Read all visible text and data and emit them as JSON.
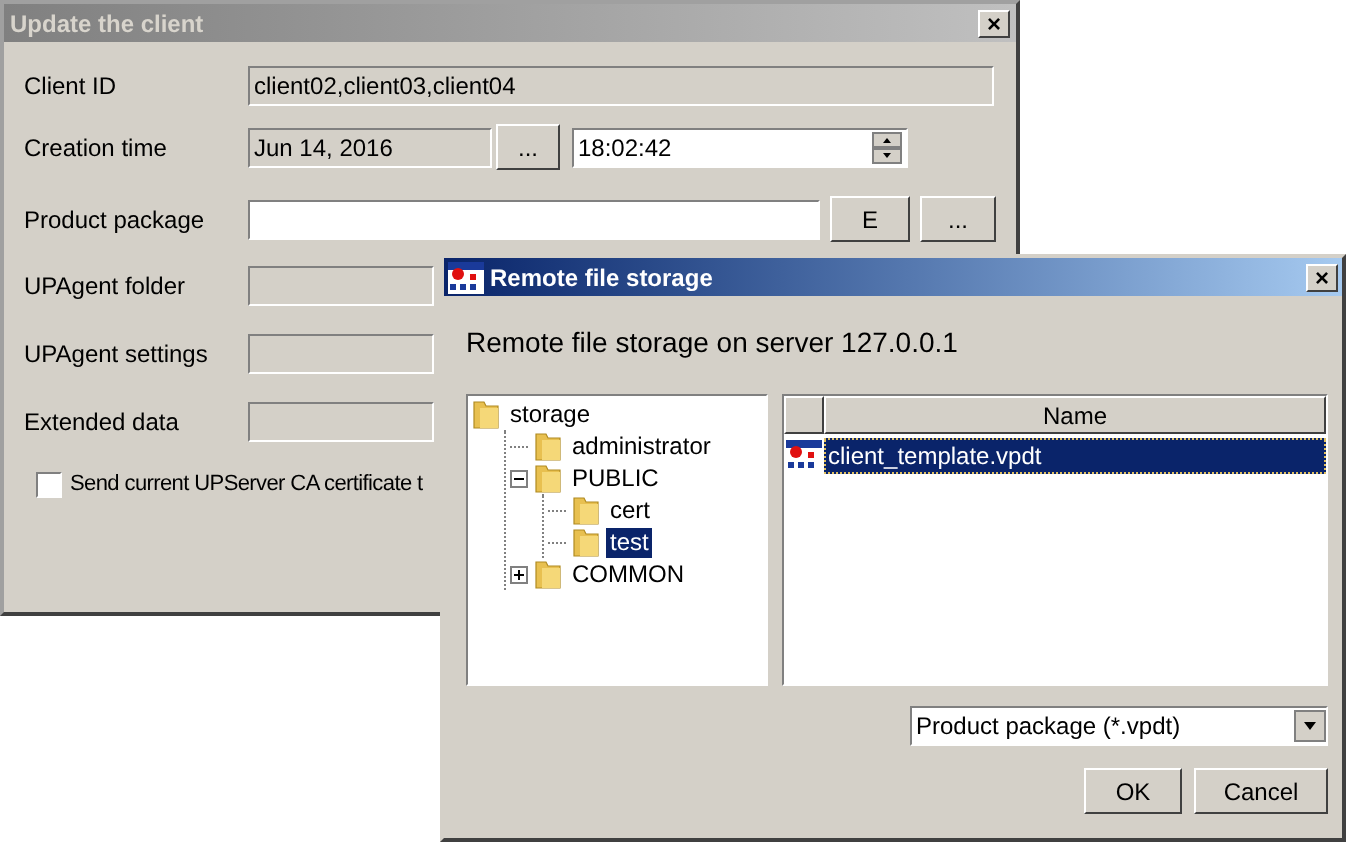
{
  "main_window": {
    "title": "Update the client",
    "close": "×",
    "fields": [
      {
        "label": "Client ID",
        "kind": "text",
        "disabled": true,
        "value": "client02,client03,client04"
      },
      {
        "label": "Creation time",
        "kind": "datetime",
        "disabled": true,
        "value": "Jun 14, 2016",
        "button": "...",
        "time": "18:02:42"
      },
      {
        "label": "Product package",
        "kind": "file",
        "disabled": false,
        "buttons": [
          "E",
          "..."
        ]
      },
      {
        "label": "UPAgent folder",
        "kind": "text",
        "disabled": true
      },
      {
        "label": "UPAgent settings",
        "kind": "text",
        "disabled": true
      },
      {
        "label": "Extended data",
        "kind": "text",
        "disabled": true
      }
    ],
    "checkbox": {
      "label": "Send current UPServer CA certificate t",
      "checked": false
    }
  },
  "dialog": {
    "title": "Remote file storage",
    "close": "×",
    "heading": "Remote file storage on server 127.0.0.1",
    "tree": [
      {
        "label": "storage",
        "selected": false,
        "children": [
          {
            "label": "administrator",
            "selected": false
          },
          {
            "label": "PUBLIC",
            "expanded": true,
            "selected": false,
            "children": [
              {
                "label": "cert",
                "selected": false
              },
              {
                "label": "test",
                "selected": true
              }
            ]
          },
          {
            "label": "COMMON",
            "expanded": false,
            "selected": false
          }
        ]
      }
    ],
    "table": {
      "columns": [
        "Name"
      ],
      "rows": [
        {
          "name": "client_template.vpdt",
          "selected": true
        }
      ]
    },
    "filter": "Product package (*.vpdt)",
    "buttons": [
      "OK",
      "Cancel"
    ]
  }
}
